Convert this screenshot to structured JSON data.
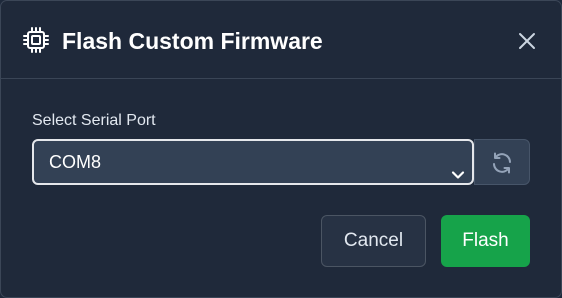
{
  "dialog": {
    "title": "Flash Custom Firmware",
    "title_icon": "chip-icon",
    "close_icon": "close-icon"
  },
  "serial_port": {
    "label": "Select Serial Port",
    "selected": "COM8",
    "dropdown_icon": "chevron-down-icon",
    "refresh_icon": "refresh-icon"
  },
  "actions": {
    "cancel_label": "Cancel",
    "flash_label": "Flash"
  },
  "colors": {
    "background": "#1f293a",
    "accent": "#16a34a",
    "input_background": "#334155"
  }
}
